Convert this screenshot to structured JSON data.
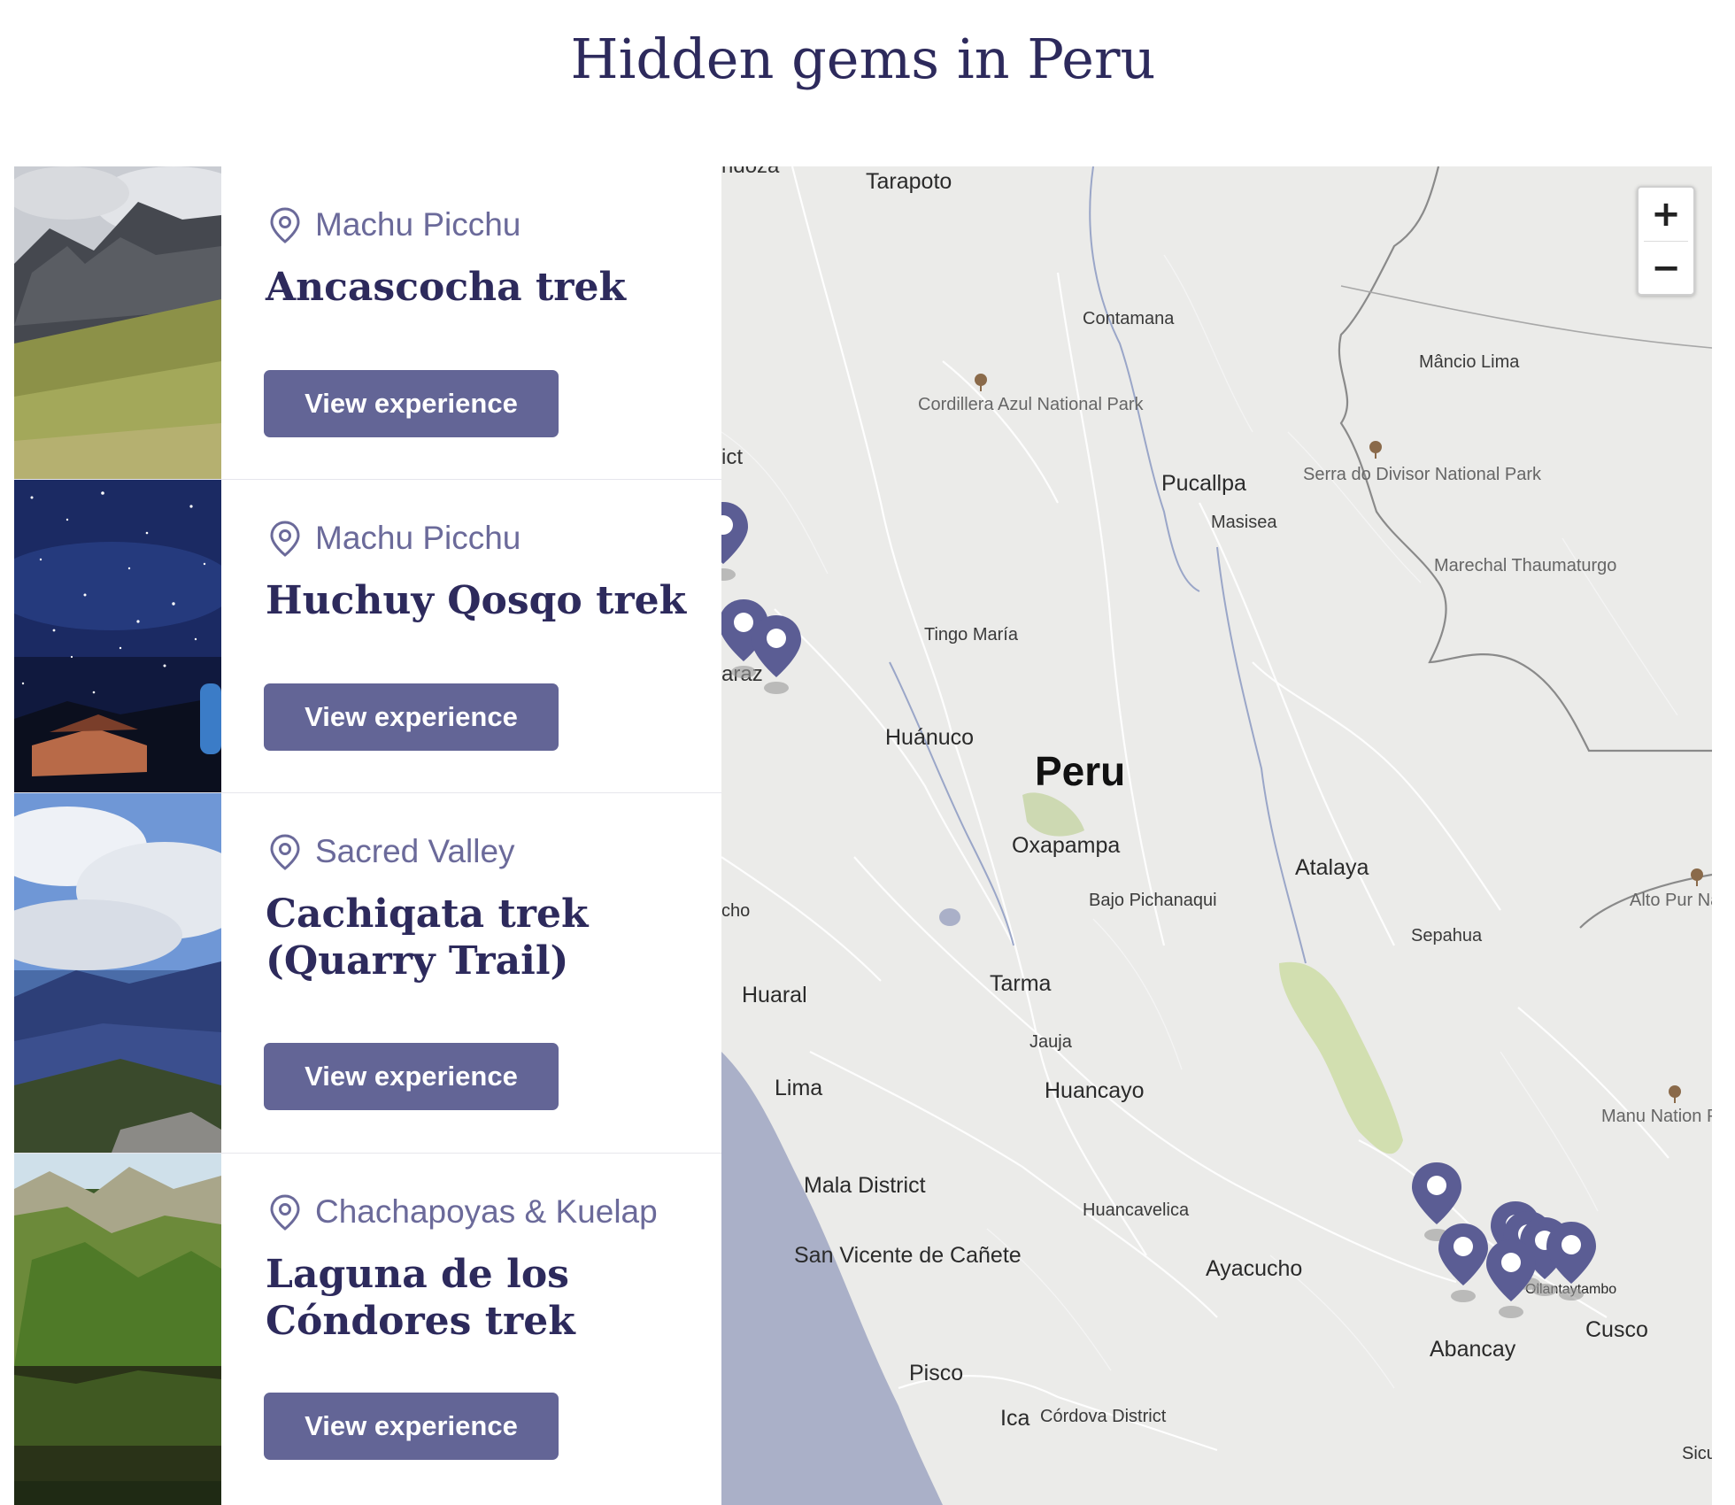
{
  "page": {
    "title": "Hidden gems in Peru"
  },
  "experiences": [
    {
      "location": "Machu Picchu",
      "title": "Ancascocha trek",
      "button": "View experience",
      "image": "mountain-valley-photo"
    },
    {
      "location": "Machu Picchu",
      "title": "Huchuy Qosqo trek",
      "button": "View experience",
      "image": "starry-night-camp-photo"
    },
    {
      "location": "Sacred Valley",
      "title": "Cachiqata trek (Quarry Trail)",
      "button": "View experience",
      "image": "cloudy-mountain-photo"
    },
    {
      "location": "Chachapoyas & Kuelap",
      "title": "Laguna de los Cóndores trek",
      "button": "View experience",
      "image": "lake-cliffs-photo"
    }
  ],
  "map": {
    "zoom_in": "+",
    "zoom_out": "−",
    "country": "Peru",
    "cities": [
      "Tarapoto",
      "Contamana",
      "Pucallpa",
      "Masisea",
      "Tingo María",
      "Huánuco",
      "Oxapampa",
      "Bajo Pichanaqui",
      "Atalaya",
      "Sepahua",
      "Tarma",
      "Jauja",
      "Huancayo",
      "Huaral",
      "Lima",
      "Mala District",
      "San Vicente de Cañete",
      "Huancavelica",
      "Ayacucho",
      "Abancay",
      "Cusco",
      "Ollantaytambo",
      "Pisco",
      "Ica",
      "Córdova District",
      "Mâncio Lima",
      "Marechal Thaumaturgo"
    ],
    "parks": [
      "Cordillera Azul National Park",
      "Serra do Divisor National Park",
      "Alto Pur National P",
      "Manu Nation Park"
    ],
    "clipped_labels": [
      "ndoza",
      "ict",
      "araz",
      "cho",
      "Sicu"
    ],
    "marker_color": "#5b5d94"
  }
}
